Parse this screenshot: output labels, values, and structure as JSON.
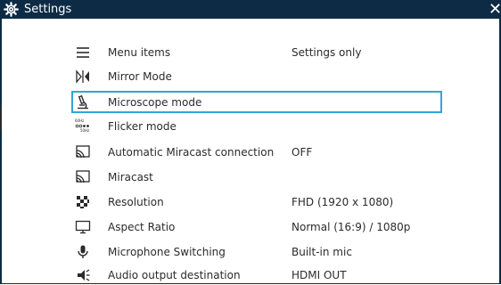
{
  "window": {
    "title": "Settings",
    "title_icon": "gear-icon",
    "close_icon": "close-icon",
    "close_glyph": "✕"
  },
  "colors": {
    "titlebar": "#0d2b45",
    "selection_border": "#2fa6d9",
    "text": "#2b2b2b"
  },
  "settings": {
    "items": [
      {
        "label": "Menu items",
        "value": "Settings only",
        "icon": "menu-icon"
      },
      {
        "label": "Mirror Mode",
        "value": "",
        "icon": "mirror-icon"
      },
      {
        "label": "Microscope mode",
        "value": "",
        "icon": "microscope-icon",
        "selected": true
      },
      {
        "label": "Flicker mode",
        "value": "",
        "icon": "flicker-icon"
      },
      {
        "label": "Automatic Miracast connection",
        "value": "OFF",
        "icon": "miracast-icon"
      },
      {
        "label": "Miracast",
        "value": "",
        "icon": "miracast-icon"
      },
      {
        "label": "Resolution",
        "value": "FHD (1920 x 1080)",
        "icon": "resolution-icon"
      },
      {
        "label": "Aspect Ratio",
        "value": "Normal (16:9) / 1080p",
        "icon": "monitor-icon"
      },
      {
        "label": "Microphone Switching",
        "value": "Built-in mic",
        "icon": "microphone-icon"
      },
      {
        "label": "Audio output destination",
        "value": "HDMI OUT",
        "icon": "speaker-icon"
      }
    ],
    "flicker_icon_text": {
      "top": "60Hz",
      "bottom": "50Hz"
    }
  }
}
